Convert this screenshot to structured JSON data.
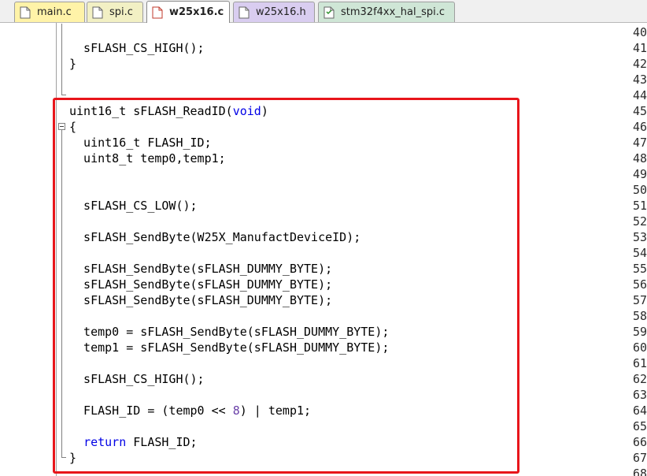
{
  "tabs": [
    {
      "label": "main.c",
      "color": "#fff3a8",
      "icon": "c-file-icon",
      "active": false
    },
    {
      "label": "spi.c",
      "color": "#f2f0c4",
      "icon": "c-file-icon",
      "active": false
    },
    {
      "label": "w25x16.c",
      "color": "#ffffff",
      "icon": "c-file-icon",
      "active": true
    },
    {
      "label": "w25x16.h",
      "color": "#d9cdf0",
      "icon": "h-file-icon",
      "active": false
    },
    {
      "label": "stm32f4xx_hal_spi.c",
      "color": "#cfe6d6",
      "icon": "c-file-icon",
      "active": false
    }
  ],
  "line_numbers": [
    "40",
    "41",
    "42",
    "43",
    "44",
    "45",
    "46",
    "47",
    "48",
    "49",
    "50",
    "51",
    "52",
    "53",
    "54",
    "55",
    "56",
    "57",
    "58",
    "59",
    "60",
    "61",
    "62",
    "63",
    "64",
    "65",
    "66",
    "67",
    "68"
  ],
  "code": {
    "l41": "  sFLASH_CS_HIGH();",
    "l42": "}",
    "l45_a": "uint16_t sFLASH_ReadID(",
    "l45_kw": "void",
    "l45_b": ")",
    "l46": "{",
    "l47": "  uint16_t FLASH_ID;",
    "l48": "  uint8_t temp0,temp1;",
    "l51": "  sFLASH_CS_LOW();",
    "l53": "  sFLASH_SendByte(W25X_ManufactDeviceID);",
    "l55": "  sFLASH_SendByte(sFLASH_DUMMY_BYTE);",
    "l56": "  sFLASH_SendByte(sFLASH_DUMMY_BYTE);",
    "l57": "  sFLASH_SendByte(sFLASH_DUMMY_BYTE);",
    "l59": "  temp0 = sFLASH_SendByte(sFLASH_DUMMY_BYTE);",
    "l60": "  temp1 = sFLASH_SendByte(sFLASH_DUMMY_BYTE);",
    "l62": "  sFLASH_CS_HIGH();",
    "l64_a": "  FLASH_ID = (temp0 << ",
    "l64_num": "8",
    "l64_b": ") | temp1;",
    "l66_pre": "  ",
    "l66_kw": "return",
    "l66_post": " FLASH_ID;",
    "l67": "}"
  },
  "colors": {
    "highlight_box": "#e8151b",
    "keyword": "#0000e6",
    "number": "#6a40a8"
  }
}
